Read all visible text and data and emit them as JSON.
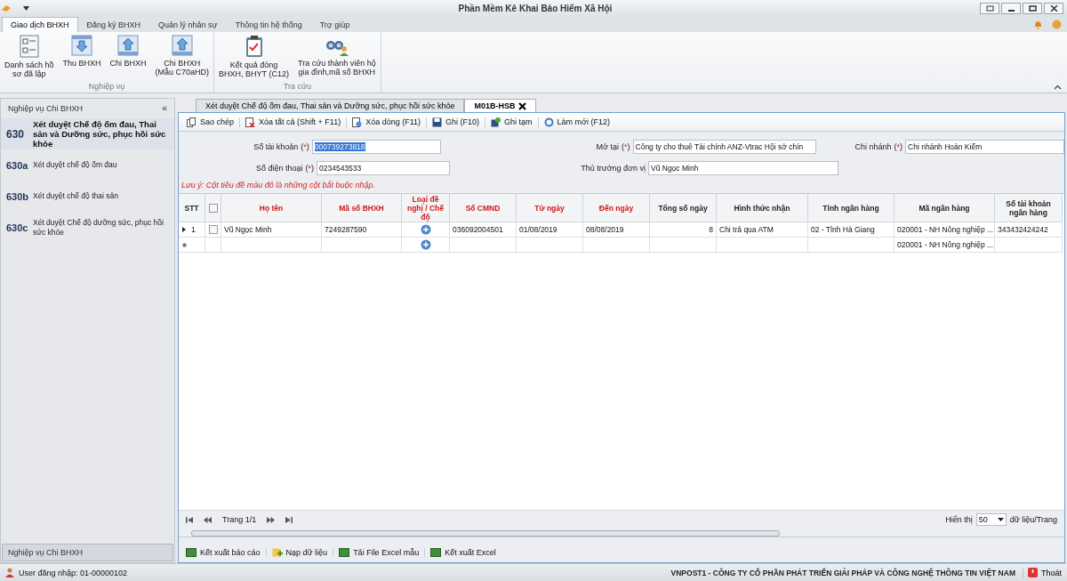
{
  "window": {
    "title": "Phần Mềm Kê Khai Bảo Hiểm Xã Hội"
  },
  "ribbon": {
    "tabs": [
      {
        "label": "Giao dịch BHXH",
        "selected": true
      },
      {
        "label": "Đăng ký BHXH",
        "selected": false
      },
      {
        "label": "Quản lý nhân sự",
        "selected": false
      },
      {
        "label": "Thông tin hệ thống",
        "selected": false
      },
      {
        "label": "Trợ giúp",
        "selected": false
      }
    ],
    "groups": [
      {
        "label": "Nghiệp vụ",
        "buttons": [
          {
            "kind": "list",
            "lines": [
              "Danh sách hồ",
              "sơ đã lập"
            ]
          },
          {
            "kind": "down",
            "lines": [
              "Thu BHXH"
            ]
          },
          {
            "kind": "up",
            "lines": [
              "Chi BHXH"
            ]
          },
          {
            "kind": "up",
            "lines": [
              "Chi BHXH",
              "(Mẫu C70aHD)"
            ]
          }
        ]
      },
      {
        "label": "Tra cứu",
        "buttons": [
          {
            "kind": "clipboard",
            "lines": [
              "Kết quả đóng",
              "BHXH, BHYT (C12)"
            ]
          },
          {
            "kind": "binoculars",
            "lines": [
              "Tra cứu thành viên hộ",
              "gia đình,mã số BHXH"
            ]
          }
        ]
      }
    ]
  },
  "sidebar": {
    "title": "Nghiệp vụ Chi BHXH",
    "collapse": "«",
    "items": [
      {
        "code": "630",
        "label": "Xét duyệt Chế độ ốm đau, Thai sản và Dưỡng sức, phục hồi sức khỏe",
        "selected": true
      },
      {
        "code": "630a",
        "label": "Xét duyệt chế độ ốm đau",
        "selected": false
      },
      {
        "code": "630b",
        "label": "Xét duyệt chế độ thai sản",
        "selected": false
      },
      {
        "code": "630c",
        "label": "Xét duyệt Chế độ dưỡng sức, phục hồi sức khỏe",
        "selected": false
      }
    ],
    "footer": "Nghiệp vụ Chi BHXH"
  },
  "doc_tabs": [
    {
      "label": "Xét duyệt Chế độ ốm đau, Thai sản và Dưỡng sức, phục hồi sức khỏe",
      "selected": false
    },
    {
      "label": "M01B-HSB",
      "selected": true
    }
  ],
  "toolbar": [
    {
      "kind": "copy",
      "label": "Sao chép"
    },
    {
      "kind": "delete-all",
      "label": "Xóa tất cả (Shift + F11)"
    },
    {
      "kind": "delete-row",
      "label": "Xóa dòng (F11)"
    },
    {
      "kind": "save",
      "label": "Ghi (F10)"
    },
    {
      "kind": "draft",
      "label": "Ghi tạm"
    },
    {
      "kind": "refresh",
      "label": "Làm mới (F12)"
    }
  ],
  "form": {
    "rows": [
      [
        {
          "label": "Số tài khoản",
          "mark": "(*)",
          "value": "000739273818",
          "selected": true
        },
        {
          "label": "Mở tại",
          "mark": "(*)",
          "value": "Công ty cho thuê Tài chính ANZ-Vtrac Hội sở chín",
          "selected": false
        },
        {
          "label": "Chi nhánh",
          "mark": "(*)",
          "value": "Chi nhánh Hoàn Kiếm",
          "selected": false
        }
      ],
      [
        {
          "label": "Số điện thoại",
          "mark": "(*)",
          "value": "0234543533",
          "selected": false
        },
        {
          "label": "Thủ trưởng đơn vị",
          "value": "Vũ Ngọc Minh",
          "selected": false
        }
      ]
    ]
  },
  "note": "Lưu ý: Cột tiêu đề màu đỏ là những cột bắt buộc nhập.",
  "table": {
    "columns": [
      {
        "label": "STT",
        "kind": "stt",
        "required": false
      },
      {
        "kind": "check",
        "checked": false
      },
      {
        "label": "Họ tên",
        "kind": "text",
        "required": true
      },
      {
        "label": "Mã số BHXH",
        "kind": "text",
        "required": true
      },
      {
        "label": "Loại đề nghị / Chế độ",
        "kind": "icon",
        "required": true
      },
      {
        "label": "Số CMND",
        "kind": "text",
        "required": true
      },
      {
        "label": "Từ ngày",
        "kind": "text",
        "required": true
      },
      {
        "label": "Đến ngày",
        "kind": "text",
        "required": true
      },
      {
        "label": "Tổng số ngày",
        "kind": "num",
        "required": false
      },
      {
        "label": "Hình thức nhận",
        "kind": "text",
        "required": false
      },
      {
        "label": "Tỉnh ngân hàng",
        "kind": "text",
        "required": false
      },
      {
        "label": "Mã ngân hàng",
        "kind": "text",
        "required": false
      },
      {
        "label": "Số tài khoản ngân hàng",
        "kind": "text",
        "required": false
      }
    ],
    "rows": [
      {
        "kind": "current",
        "checked": false,
        "cells": [
          "1",
          "",
          "Vũ Ngọc Minh",
          "7249287590",
          "",
          "036092004501",
          "01/08/2019",
          "08/08/2019",
          "8",
          "Chi trả qua ATM",
          "02 - Tỉnh Hà Giang",
          "020001 - NH Nông nghiệp ...",
          "343432424242"
        ]
      },
      {
        "kind": "new",
        "cells": [
          "",
          "",
          "",
          "",
          "",
          "",
          "",
          "",
          "",
          "",
          "",
          "020001 - NH Nông nghiệp ...",
          ""
        ]
      }
    ]
  },
  "pager": {
    "page": "Trang 1/1",
    "show_label": "Hiển thị",
    "page_size": "50",
    "unit": "dữ liệu/Trang"
  },
  "bottom_toolbar": [
    {
      "kind": "excel",
      "label": "Kết xuất báo cáo"
    },
    {
      "kind": "import",
      "label": "Nạp dữ liệu"
    },
    {
      "kind": "excel",
      "label": "Tải File Excel mẫu"
    },
    {
      "kind": "excel",
      "label": "Kết xuất Excel"
    }
  ],
  "status_bar": {
    "user": "User đăng nhập: 01-00000102",
    "company": "VNPOST1 - CÔNG TY CỔ PHẦN PHÁT TRIỂN GIẢI PHÁP VÀ CÔNG NGHỆ THÔNG TIN VIỆT NAM",
    "logout": "Thoát"
  }
}
